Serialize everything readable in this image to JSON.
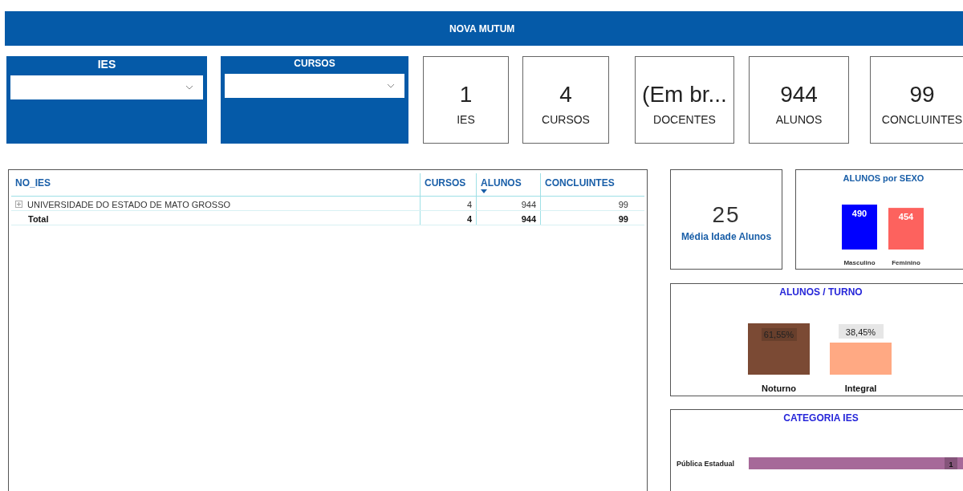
{
  "header": {
    "title": "NOVA MUTUM"
  },
  "filters": [
    {
      "label": "IES"
    },
    {
      "label": "CURSOS"
    }
  ],
  "cards": [
    {
      "value": "1",
      "label": "IES"
    },
    {
      "value": "4",
      "label": "CURSOS"
    },
    {
      "value": "(Em br...",
      "label": "DOCENTES"
    },
    {
      "value": "944",
      "label": "ALUNOS"
    },
    {
      "value": "99",
      "label": "CONCLUINTES"
    }
  ],
  "table": {
    "columns": [
      {
        "label": "NO_IES",
        "sorted": false
      },
      {
        "label": "CURSOS",
        "sorted": false
      },
      {
        "label": "ALUNOS",
        "sorted": true
      },
      {
        "label": "CONCLUINTES",
        "sorted": false
      }
    ],
    "rows": [
      {
        "kind": "group",
        "cells": [
          "UNIVERSIDADE DO ESTADO DE MATO GROSSO",
          "4",
          "944",
          "99"
        ]
      },
      {
        "kind": "total",
        "cells": [
          "Total",
          "4",
          "944",
          "99"
        ]
      }
    ]
  },
  "age_card": {
    "value": "25",
    "label": "Média Idade Alunos"
  },
  "sexo": {
    "chart_data": {
      "type": "bar",
      "title": "ALUNOS por SEXO",
      "data_labels": true,
      "series": [
        {
          "name": "Masculino",
          "color": "#0000ff",
          "values": [
            490
          ]
        },
        {
          "name": "Feminino",
          "color": "#fd625e",
          "values": [
            454
          ]
        }
      ]
    }
  },
  "turno": {
    "chart_data": {
      "type": "bar",
      "title": "ALUNOS / TURNO",
      "categories": [
        "Noturno",
        "Integral"
      ],
      "values": [
        61.55,
        38.45
      ],
      "value_labels": [
        "61,55%",
        "38,45%"
      ]
    }
  },
  "categoria": {
    "chart_data": {
      "type": "bar",
      "orientation": "horizontal",
      "title": "CATEGORIA  IES",
      "data_labels": true,
      "categories": [
        "Pública Estadual"
      ],
      "values": [
        1
      ]
    }
  }
}
